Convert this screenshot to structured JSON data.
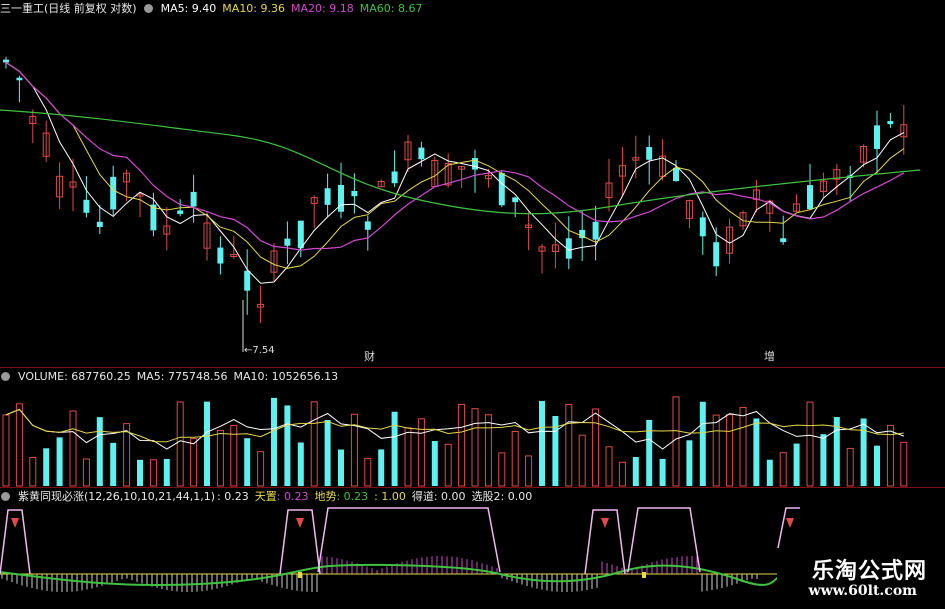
{
  "price_panel": {
    "title": "三一重工(日线 前复权 对数)",
    "ma5": "MA5: 9.40",
    "ma10": "MA10: 9.36",
    "ma20": "MA20: 9.18",
    "ma60": "MA60: 8.67",
    "low_marker": "7.54",
    "note1": "财",
    "note2": "增"
  },
  "volume_panel": {
    "volume": "VOLUME: 687760.25",
    "ma5": "MA5: 775748.56",
    "ma10": "MA10: 1052656.13"
  },
  "indicator_panel": {
    "name": "紫黄同现必涨(12,26,10,10,21,44,1,1)",
    "v0": ": 0.23",
    "tianzhi_label": "天置",
    "tianzhi_value": ": 0.23",
    "dishi_label": "地势",
    "dishi_value": ": 0.23",
    "v3": ": 1.00",
    "dedao_label": "得道",
    "dedao_value": ": 0.00",
    "xuangu_label": "选股2",
    "xuangu_value": ": 0.00"
  },
  "colors": {
    "up": "#e04a4a",
    "down": "#5ff0f0",
    "ma5": "#ffffff",
    "ma10": "#e6d84a",
    "ma20": "#d04ad0",
    "ma60": "#3fc23f"
  },
  "watermark": {
    "line1": "乐淘公式网",
    "line2": "www.60lt.com"
  }
}
